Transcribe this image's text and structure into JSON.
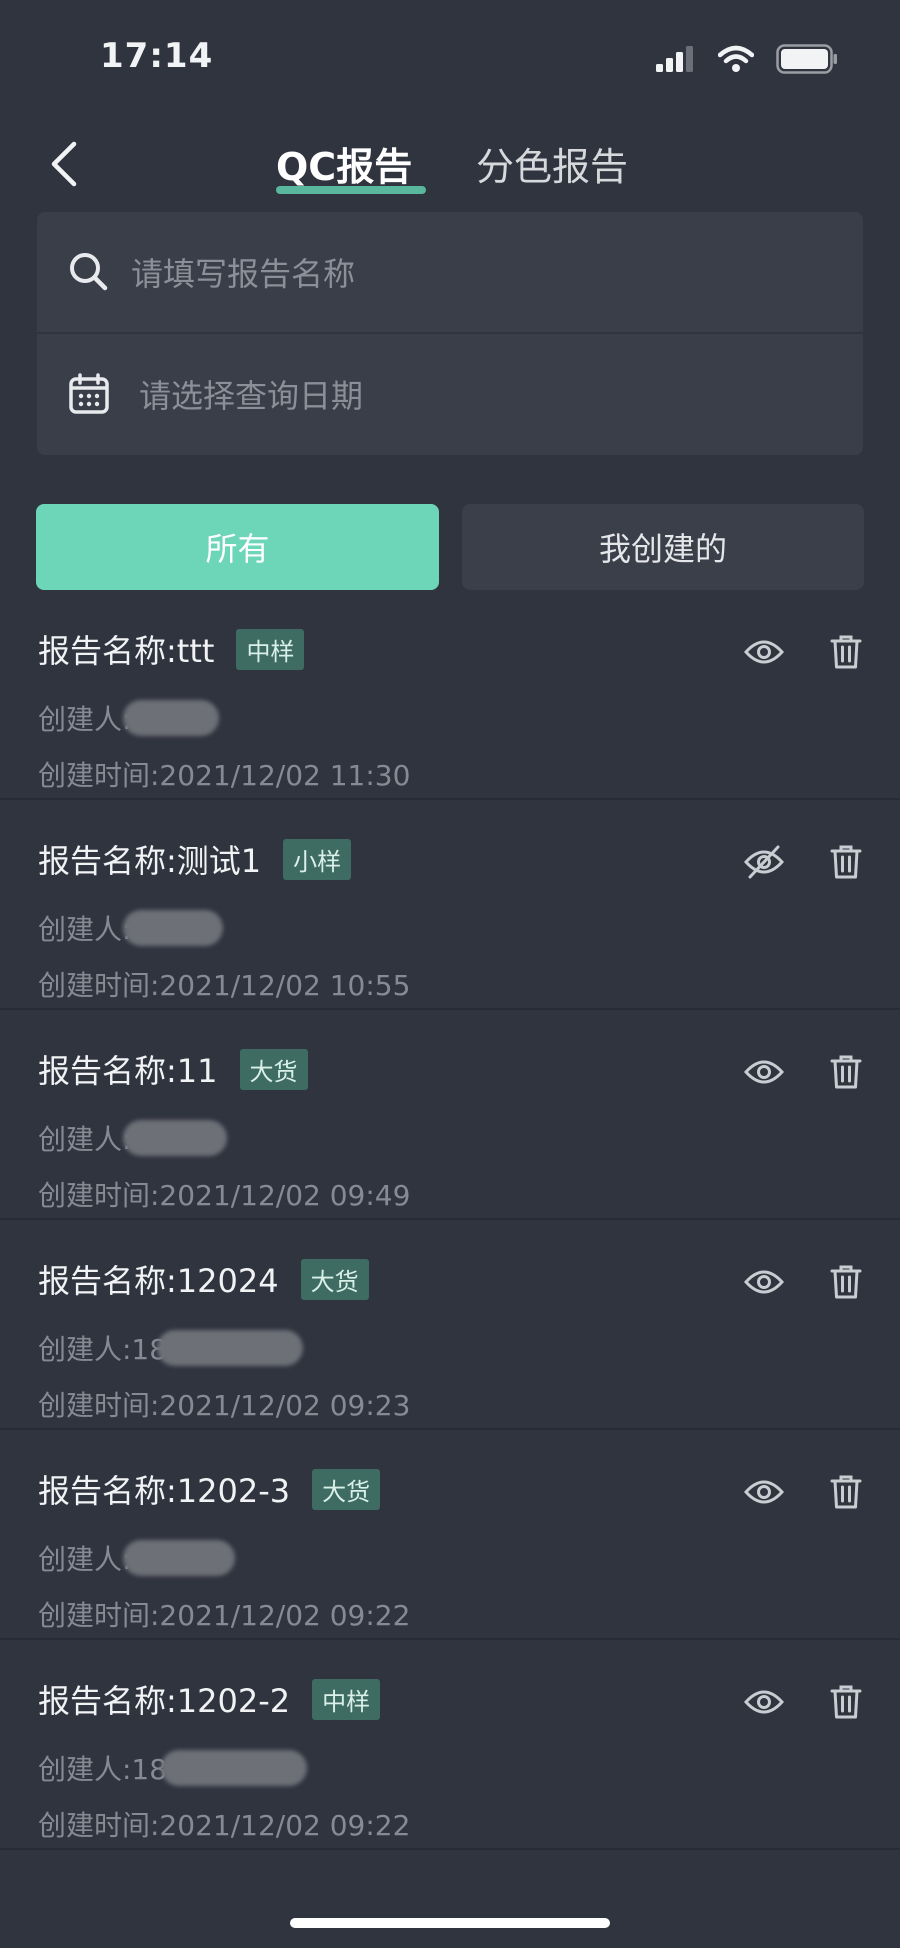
{
  "status_bar": {
    "time": "17:14"
  },
  "nav": {
    "tab_qc": "QC报告",
    "tab_color": "分色报告"
  },
  "search": {
    "name_placeholder": "请填写报告名称",
    "date_placeholder": "请选择查询日期"
  },
  "filters": {
    "all": "所有",
    "mine": "我创建的"
  },
  "reports": [
    {
      "name": "报告名称:ttt",
      "tag": "中样",
      "creator_prefix": "创建人:",
      "created": "创建时间:2021/12/02 11:30",
      "visible": true
    },
    {
      "name": "报告名称:测试1",
      "tag": "小样",
      "creator_prefix": "创建人:",
      "created": "创建时间:2021/12/02 10:55",
      "visible": false
    },
    {
      "name": "报告名称:11",
      "tag": "大货",
      "creator_prefix": "创建人:",
      "created": "创建时间:2021/12/02 09:49",
      "visible": true
    },
    {
      "name": "报告名称:12024",
      "tag": "大货",
      "creator_prefix": "创建人:18",
      "created": "创建时间:2021/12/02 09:23",
      "visible": true
    },
    {
      "name": "报告名称:1202-3",
      "tag": "大货",
      "creator_prefix": "创建人:",
      "created": "创建时间:2021/12/02 09:22",
      "visible": true
    },
    {
      "name": "报告名称:1202-2",
      "tag": "中样",
      "creator_prefix": "创建人:18",
      "created": "创建时间:2021/12/02 09:22",
      "visible": true
    }
  ],
  "icons": {
    "back": "chevron-left-icon",
    "search": "search-icon",
    "calendar": "calendar-icon",
    "view": "eye-icon",
    "hidden": "eye-off-icon",
    "delete": "trash-icon"
  },
  "colors": {
    "background": "#30343f",
    "accent": "#6dd6b8",
    "tag_bg": "#3e6b62"
  }
}
